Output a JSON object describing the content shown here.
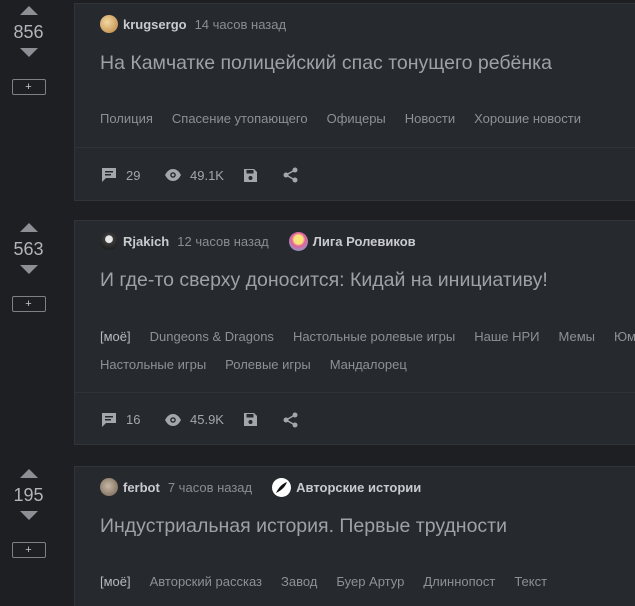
{
  "posts": [
    {
      "rating": "856",
      "add_label": "+",
      "author": "krugsergo",
      "time": "14 часов назад",
      "community": null,
      "title": "На Камчатке полицейский спас тонущего ребёнка",
      "tags_row1": [
        "Полиция",
        "Спасение утопающего",
        "Офицеры",
        "Новости",
        "Хорошие новости"
      ],
      "tags_row2": [],
      "comments": "29",
      "views": "49.1K"
    },
    {
      "rating": "563",
      "add_label": "+",
      "author": "Rjakich",
      "time": "12 часов назад",
      "community": "Лига Ролевиков",
      "title": "И где-то сверху доносится: Кидай на инициативу!",
      "tags_row1": [
        "[моё]",
        "Dungeons & Dragons",
        "Настольные ролевые игры",
        "Наше НРИ",
        "Мемы",
        "Юмор"
      ],
      "tags_row2": [
        "Настольные игры",
        "Ролевые игры",
        "Мандалорец"
      ],
      "comments": "16",
      "views": "45.9K"
    },
    {
      "rating": "195",
      "add_label": "+",
      "author": "ferbot",
      "time": "7 часов назад",
      "community": "Авторские истории",
      "title": "Индустриальная история. Первые трудности",
      "tags_row1": [
        "[моё]",
        "Авторский рассказ",
        "Завод",
        "Буер Артур",
        "Длиннопост",
        "Текст"
      ],
      "tags_row2": []
    }
  ],
  "colors": {
    "background": "#1d1f22",
    "card": "#26292d",
    "text_title": "#9ea1a5",
    "text_meta": "#8a8d91"
  },
  "icons": [
    "comments-icon",
    "views-icon",
    "save-icon",
    "share-icon",
    "vote-up-icon",
    "vote-down-icon"
  ]
}
